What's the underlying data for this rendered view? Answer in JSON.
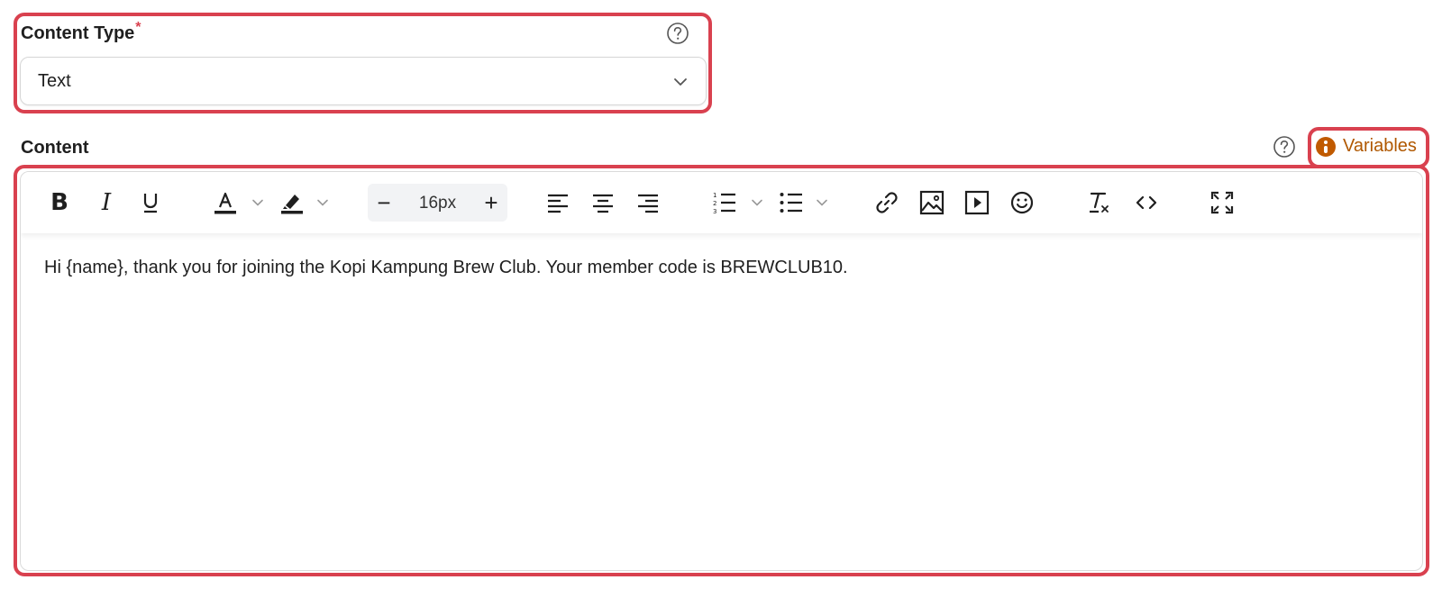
{
  "content_type": {
    "label": "Content Type",
    "required_mark": "*",
    "selected_value": "Text",
    "help_icon": "question-circle-icon",
    "dropdown_icon": "chevron-down-icon"
  },
  "content": {
    "label": "Content",
    "help_icon": "question-circle-icon",
    "variables_label": "Variables",
    "variables_icon": "info-circle-icon",
    "variables_color": "#b05800",
    "highlight_color": "#d9414f"
  },
  "toolbar": {
    "bold_label": "B",
    "italic_label": "I",
    "font_size": "16px",
    "font_size_minus": "−",
    "font_size_plus": "+",
    "icons": [
      "bold-icon",
      "italic-icon",
      "underline-icon",
      "text-color-icon",
      "highlight-icon",
      "align-left-icon",
      "align-center-icon",
      "align-right-icon",
      "ordered-list-icon",
      "bullet-list-icon",
      "link-icon",
      "image-icon",
      "video-icon",
      "emoji-icon",
      "clear-format-icon",
      "code-icon",
      "fullscreen-icon"
    ]
  },
  "editor": {
    "body_text": "Hi {name}, thank you for joining the Kopi Kampung Brew Club. Your member code is BREWCLUB10."
  }
}
